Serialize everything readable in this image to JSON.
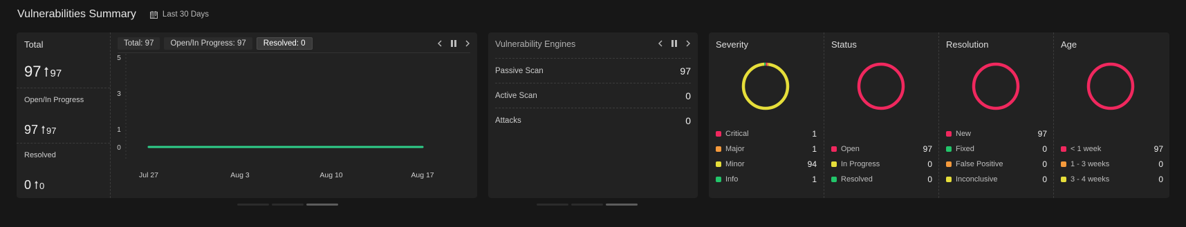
{
  "header": {
    "title": "Vulnerabilities Summary",
    "date_range": "Last 30 Days"
  },
  "totals": {
    "total": {
      "label": "Total",
      "value": "97",
      "change": "97"
    },
    "open": {
      "label": "Open/In Progress",
      "value": "97",
      "change": "97"
    },
    "resolved": {
      "label": "Resolved",
      "value": "0",
      "change": "0"
    }
  },
  "trend_chart": {
    "tabs": [
      {
        "label": "Total: 97",
        "active": false
      },
      {
        "label": "Open/In Progress: 97",
        "active": false
      },
      {
        "label": "Resolved: 0",
        "active": true
      }
    ],
    "colors": {
      "line": "#2fcf8a",
      "tick_text": "#cfcfcf"
    }
  },
  "chart_data": {
    "type": "line",
    "x": [
      "Jul 27",
      "Aug 3",
      "Aug 10",
      "Aug 17"
    ],
    "series": [
      {
        "values": [
          0,
          0,
          0,
          0
        ]
      }
    ],
    "ylim": [
      0,
      5
    ],
    "yticks": [
      0,
      1,
      3,
      5
    ],
    "xlabel": "",
    "ylabel": ""
  },
  "engines": {
    "title": "Vulnerability Engines",
    "rows": [
      {
        "label": "Passive Scan",
        "value": "97"
      },
      {
        "label": "Active Scan",
        "value": "0"
      },
      {
        "label": "Attacks",
        "value": "0"
      }
    ]
  },
  "breakdowns": [
    {
      "title": "Severity",
      "ring": "yellow-ring",
      "segments": [
        {
          "name": "Critical",
          "value": 1,
          "color": "#f0285e"
        },
        {
          "name": "Major",
          "value": 1,
          "color": "#f59a3c"
        },
        {
          "name": "Minor",
          "value": 94,
          "color": "#e6de3a"
        },
        {
          "name": "Info",
          "value": 1,
          "color": "#22c56a"
        }
      ],
      "items": [
        {
          "label": "Critical",
          "value": "1",
          "color": "#f0285e"
        },
        {
          "label": "Major",
          "value": "1",
          "color": "#f59a3c"
        },
        {
          "label": "Minor",
          "value": "94",
          "color": "#e6de3a"
        },
        {
          "label": "Info",
          "value": "1",
          "color": "#22c56a"
        }
      ]
    },
    {
      "title": "Status",
      "segments": [
        {
          "name": "Open",
          "value": 97,
          "color": "#f0285e"
        }
      ],
      "items": [
        {
          "label": "Open",
          "value": "97",
          "color": "#f0285e"
        },
        {
          "label": "In Progress",
          "value": "0",
          "color": "#e6de3a"
        },
        {
          "label": "Resolved",
          "value": "0",
          "color": "#22c56a"
        }
      ]
    },
    {
      "title": "Resolution",
      "segments": [
        {
          "name": "New",
          "value": 97,
          "color": "#f0285e"
        }
      ],
      "items": [
        {
          "label": "New",
          "value": "97",
          "color": "#f0285e"
        },
        {
          "label": "Fixed",
          "value": "0",
          "color": "#22c56a"
        },
        {
          "label": "False Positive",
          "value": "0",
          "color": "#f59a3c"
        },
        {
          "label": "Inconclusive",
          "value": "0",
          "color": "#e6de3a"
        }
      ]
    },
    {
      "title": "Age",
      "segments": [
        {
          "name": "< 1 week",
          "value": 97,
          "color": "#f0285e"
        }
      ],
      "items": [
        {
          "label": "< 1 week",
          "value": "97",
          "color": "#f0285e"
        },
        {
          "label": "1 - 3 weeks",
          "value": "0",
          "color": "#f59a3c"
        },
        {
          "label": "3 - 4 weeks",
          "value": "0",
          "color": "#e6de3a"
        }
      ]
    }
  ],
  "pagers": [
    {
      "name": "trend",
      "pages": 3,
      "active": 3
    },
    {
      "name": "engines",
      "pages": 3,
      "active": 3
    }
  ]
}
